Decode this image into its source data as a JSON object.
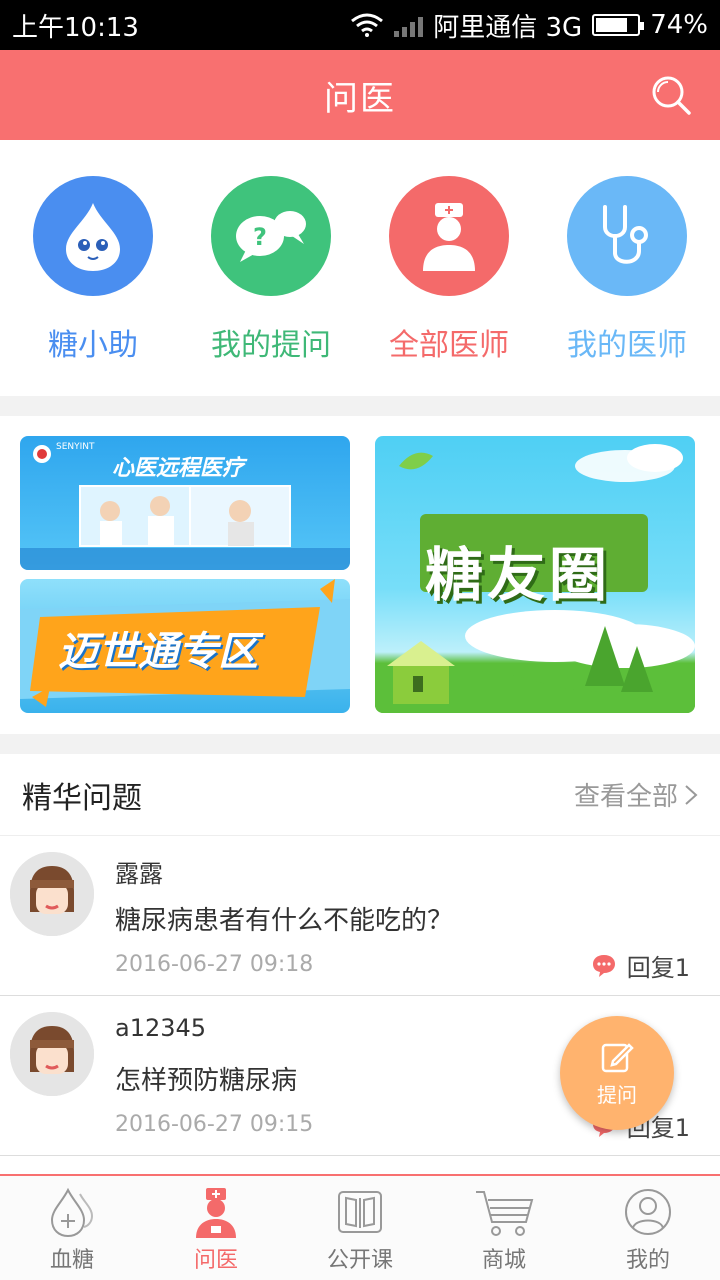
{
  "status_bar": {
    "time": "上午10:13",
    "carrier": "阿里通信 3G",
    "battery": "74%"
  },
  "header": {
    "title": "问医"
  },
  "quick_actions": [
    {
      "label": "糖小助",
      "color": "#4a8ef0",
      "label_color": "#4a8ef0"
    },
    {
      "label": "我的提问",
      "color": "#3fc37c",
      "label_color": "#3fb877"
    },
    {
      "label": "全部医师",
      "color": "#f46a6a",
      "label_color": "#f46a6a"
    },
    {
      "label": "我的医师",
      "color": "#6ab8f7",
      "label_color": "#6ab8f7"
    }
  ],
  "banners": {
    "remote_medical": {
      "logo": "SENYINT",
      "title": "心医远程医疗"
    },
    "mystr_zone": {
      "title": "迈世通专区"
    },
    "sugar_circle": {
      "title": "糖友圈"
    }
  },
  "featured": {
    "title": "精华问题",
    "more": "查看全部",
    "questions": [
      {
        "user": "露露",
        "text": "糖尿病患者有什么不能吃的？",
        "time": "2016-06-27 09:18",
        "reply": "回复1"
      },
      {
        "user": "a12345",
        "text": "怎样预防糖尿病",
        "time": "2016-06-27 09:15",
        "reply": "回复1"
      }
    ]
  },
  "fab": {
    "label": "提问"
  },
  "tabbar": [
    {
      "label": "血糖"
    },
    {
      "label": "问医"
    },
    {
      "label": "公开课"
    },
    {
      "label": "商城"
    },
    {
      "label": "我的"
    }
  ]
}
